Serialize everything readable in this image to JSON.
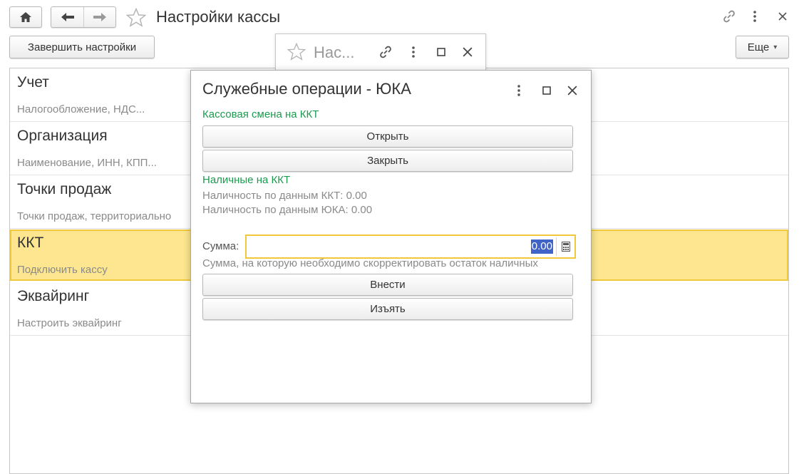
{
  "window": {
    "title": "Настройки кассы",
    "finish_button": "Завершить настройки",
    "more_button": "Еще",
    "more_chevron": "▾"
  },
  "list": {
    "items": [
      {
        "name": "Учет",
        "description": "Налогообложение, НДС..."
      },
      {
        "name": "Организация",
        "description": "Наименование, ИНН, КПП..."
      },
      {
        "name": "Точки продаж",
        "description": "Точки продаж, территориально"
      },
      {
        "name": "ККТ",
        "description": "Подключить кассу"
      },
      {
        "name": "Эквайринг",
        "description": "Настроить эквайринг"
      }
    ],
    "selected_index": 3
  },
  "background_window": {
    "title": "Нас..."
  },
  "dialog": {
    "title": "Служебные операции - ЮКА",
    "shift_group": "Кассовая смена на ККТ",
    "open_button": "Открыть",
    "close_button": "Закрыть",
    "cash_group": "Наличные на ККТ",
    "cash_kkt": "Наличность по данным ККТ: 0.00",
    "cash_yuka": "Наличность по данным ЮКА: 0.00",
    "sum_label": "Сумма:",
    "sum_value": "0.00",
    "sum_hint": "Сумма, на которую необходимо скорректировать остаток наличных",
    "deposit_button": "Внести",
    "withdraw_button": "Изъять"
  },
  "colors": {
    "accent_green": "#1c9a4f",
    "selection_yellow": "#fde68f",
    "selection_border": "#f0c93a",
    "text_selection": "#3f63c7"
  }
}
